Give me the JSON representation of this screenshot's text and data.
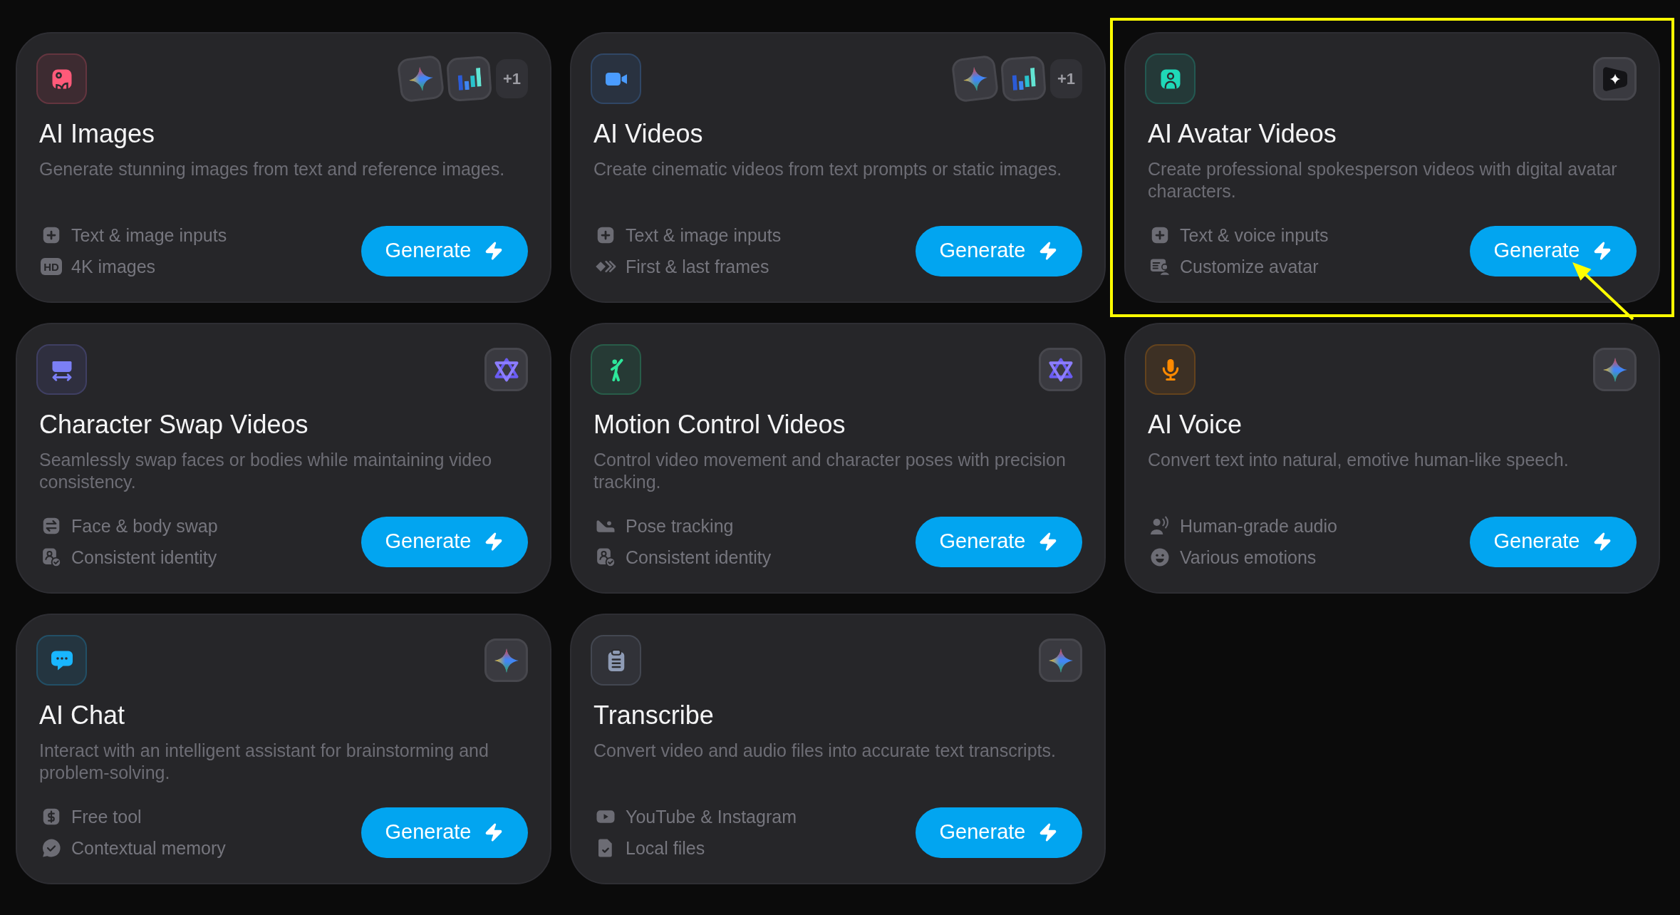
{
  "cards": [
    {
      "icon": {
        "kind": "image",
        "color": "#ff5a79"
      },
      "models": [
        {
          "kind": "sparkle"
        },
        {
          "kind": "bars"
        }
      ],
      "more_models": "+1",
      "title": "AI Images",
      "description": "Generate stunning images from text and reference images.",
      "features": [
        {
          "kind": "plus",
          "label": "Text & image inputs"
        },
        {
          "kind": "badge",
          "badge": "HD",
          "label": "4K images"
        }
      ],
      "button": "Generate",
      "highlighted": false
    },
    {
      "icon": {
        "kind": "video",
        "color": "#4a9cff"
      },
      "models": [
        {
          "kind": "sparkle"
        },
        {
          "kind": "bars"
        }
      ],
      "more_models": "+1",
      "title": "AI Videos",
      "description": "Create cinematic videos from text prompts or static images.",
      "features": [
        {
          "kind": "plus",
          "label": "Text & image inputs"
        },
        {
          "kind": "frames",
          "label": "First & last frames"
        }
      ],
      "button": "Generate",
      "highlighted": false
    },
    {
      "icon": {
        "kind": "avatar",
        "color": "#1fd8b8"
      },
      "models": [
        {
          "kind": "dark-sparkle"
        }
      ],
      "title": "AI Avatar Videos",
      "description": "Create professional spokesperson videos with digital avatar characters.",
      "features": [
        {
          "kind": "plus",
          "label": "Text & voice inputs"
        },
        {
          "kind": "id-card",
          "label": "Customize avatar"
        }
      ],
      "button": "Generate",
      "highlighted": true
    },
    {
      "icon": {
        "kind": "swap",
        "color": "#7b7ff5"
      },
      "models": [
        {
          "kind": "knot"
        }
      ],
      "title": "Character Swap Videos",
      "description": "Seamlessly swap faces or bodies while maintaining video consistency.",
      "features": [
        {
          "kind": "swap",
          "label": "Face & body swap"
        },
        {
          "kind": "id-check",
          "label": "Consistent identity"
        }
      ],
      "button": "Generate",
      "highlighted": false
    },
    {
      "icon": {
        "kind": "motion",
        "color": "#2ee69a"
      },
      "models": [
        {
          "kind": "knot"
        }
      ],
      "title": "Motion Control Videos",
      "description": "Control video movement and character poses with precision tracking.",
      "features": [
        {
          "kind": "pose",
          "label": "Pose tracking"
        },
        {
          "kind": "id-check",
          "label": "Consistent identity"
        }
      ],
      "button": "Generate",
      "highlighted": false
    },
    {
      "icon": {
        "kind": "mic",
        "color": "#ff8a00"
      },
      "models": [
        {
          "kind": "sparkle"
        }
      ],
      "title": "AI Voice",
      "description": "Convert text into natural, emotive human-like speech.",
      "features": [
        {
          "kind": "voice",
          "label": "Human-grade audio"
        },
        {
          "kind": "smile",
          "label": "Various emotions"
        }
      ],
      "button": "Generate",
      "highlighted": false
    },
    {
      "icon": {
        "kind": "chat",
        "color": "#19b6ff"
      },
      "models": [
        {
          "kind": "sparkle"
        }
      ],
      "title": "AI Chat",
      "description": "Interact with an intelligent assistant for brainstorming and problem-solving.",
      "features": [
        {
          "kind": "dollar",
          "label": "Free tool"
        },
        {
          "kind": "chat-check",
          "label": "Contextual memory"
        }
      ],
      "button": "Generate",
      "highlighted": false
    },
    {
      "icon": {
        "kind": "clipboard",
        "color": "#8e9bb5"
      },
      "models": [
        {
          "kind": "sparkle"
        }
      ],
      "title": "Transcribe",
      "description": "Convert video and audio files into accurate text transcripts.",
      "features": [
        {
          "kind": "play",
          "label": "YouTube & Instagram"
        },
        {
          "kind": "file-check",
          "label": "Local files"
        }
      ],
      "button": "Generate",
      "highlighted": false
    }
  ]
}
